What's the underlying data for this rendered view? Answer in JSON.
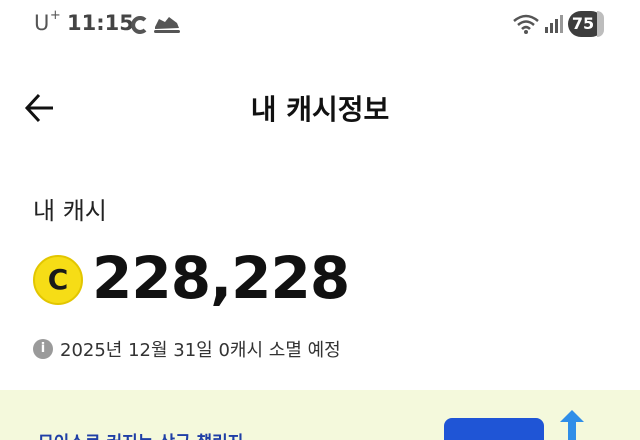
{
  "status_bar": {
    "carrier": "U",
    "carrier_sup": "+",
    "time": "11:15",
    "battery": "75",
    "icons": [
      "coupang-c-icon",
      "shoe-icon",
      "wifi-icon",
      "signal-icon",
      "battery-icon"
    ]
  },
  "header": {
    "title": "내 캐시정보",
    "back_icon": "arrow-left-icon"
  },
  "cash": {
    "label": "내 캐시",
    "coin_symbol": "C",
    "amount": "228,228",
    "expire_notice": "2025년 12월 31일 0캐시 소멸 예정",
    "info_symbol": "i"
  },
  "banner": {
    "text": "모이스로 커지는 상금 챌린지"
  },
  "colors": {
    "coin": "#f6dd16",
    "banner_bg": "#f4f9dc",
    "banner_text": "#1f3fa6",
    "accent_blue": "#1f55d6"
  }
}
